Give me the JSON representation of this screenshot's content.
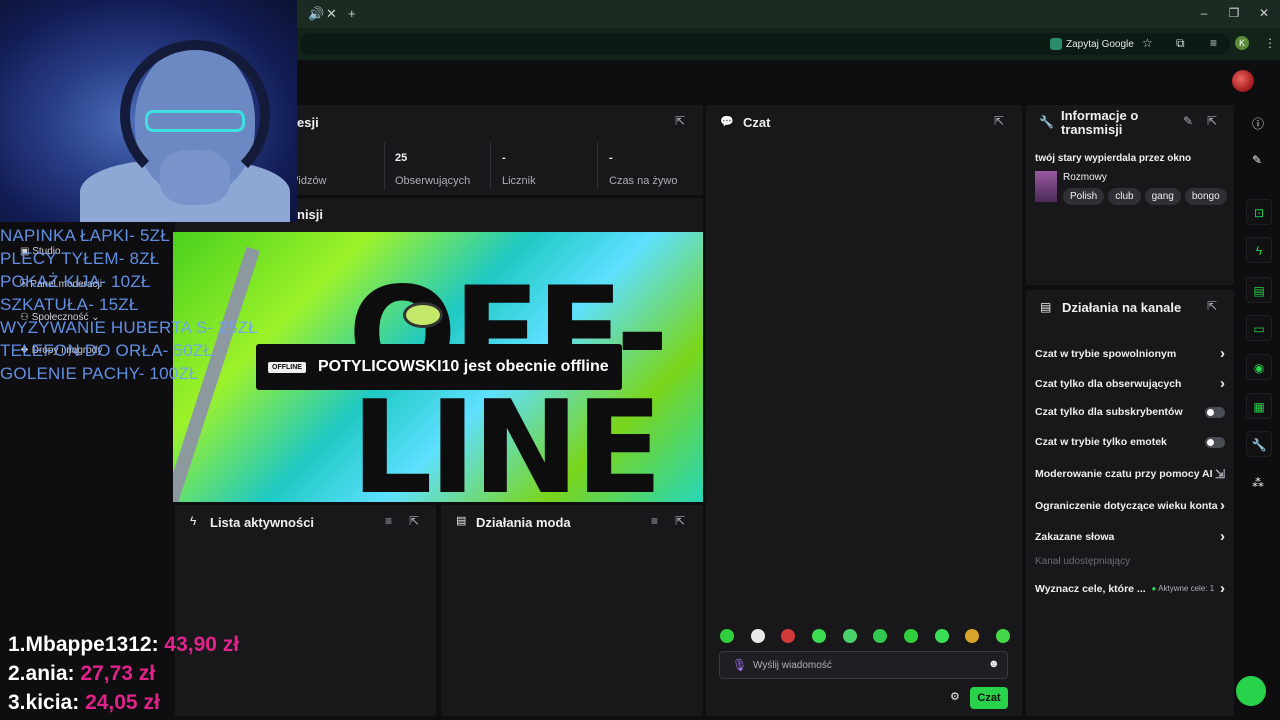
{
  "browser": {
    "tab_audio_icon": "speaker-icon",
    "tab_close": "✕",
    "new_tab": "+",
    "google_button": "Zapytaj Google",
    "profile_initial": "K",
    "window_controls": [
      "–",
      "❐",
      "✕"
    ]
  },
  "stats_panel": {
    "title_fragment": "esji",
    "stats": [
      {
        "value": "",
        "label": "Widzów"
      },
      {
        "value": "25",
        "label": "Obserwujących"
      },
      {
        "value": "-",
        "label": "Licznik subskrypcji"
      },
      {
        "value": "-",
        "label": "Czas na żywo"
      }
    ]
  },
  "preview_panel": {
    "title_fragment": "nisji"
  },
  "sidebar_menu": [
    "Studio",
    "Panel moderacji",
    "Społeczność",
    "Dropy i nagrody"
  ],
  "price_list": [
    "NAPINKA ŁAPKI- 5ZŁ",
    "PLECY TYŁEM- 8ZŁ",
    "POKAŻ KIJA- 10ZŁ",
    "SZKATUŁA- 15ZŁ",
    "WYZYWANIE HUBERTA S- 25ZŁ",
    "TELEFON DO ORŁA- 50ZŁ",
    "GOLENIE PACHY- 100ZŁ"
  ],
  "leaderboard": [
    {
      "rank": "1.",
      "name": "Mbappe1312:",
      "amount": "43,90 zł"
    },
    {
      "rank": "2.",
      "name": "ania:",
      "amount": "27,73 zł"
    },
    {
      "rank": "3.",
      "name": "kicia:",
      "amount": "24,05 zł"
    }
  ],
  "offline": {
    "big_word_1": "OFF-",
    "big_word_2": "LINE",
    "badge": "OFFLINE",
    "message": "POTYLICOWSKI10 jest obecnie offline"
  },
  "activity_panel": {
    "title": "Lista aktywności"
  },
  "mod_panel": {
    "title": "Działania moda"
  },
  "chat": {
    "title": "Czat",
    "input_placeholder": "Wyślij wiadomość",
    "send_label": "Czat",
    "emote_colors": [
      "#2fcf3f",
      "#e8e8e8",
      "#d43a3a",
      "#3ddc52",
      "#49d16a",
      "#30c84e",
      "#2fcf3f",
      "#3adf58",
      "#d9a52f",
      "#46d84a"
    ]
  },
  "info_panel": {
    "title": "Informacje o transmisji",
    "stream_title": "twój stary wypierdala przez okno",
    "category": "Rozmowy",
    "tags": [
      "Polish",
      "club",
      "gang",
      "bongo"
    ]
  },
  "channel_actions": {
    "title": "Działania na kanale",
    "items": [
      {
        "label": "Czat w trybie spowolnionym",
        "control": "chevron"
      },
      {
        "label": "Czat tylko dla obserwujących",
        "control": "chevron"
      },
      {
        "label": "Czat tylko dla subskrybentów",
        "control": "toggle"
      },
      {
        "label": "Czat w trybie tylko emotek",
        "control": "toggle"
      },
      {
        "label": "Moderowanie czatu przy pomocy AI",
        "control": "external"
      },
      {
        "label": "Ograniczenie dotyczące wieku konta",
        "control": "chevron"
      },
      {
        "label": "Zakazane słowa",
        "control": "chevron"
      }
    ],
    "shared_channel_label": "Kanał udostępniający",
    "goals_label": "Wyznacz cele, które ...",
    "goals_status": "Aktywne cele: 1"
  },
  "colors": {
    "accent": "#28d24a",
    "panel": "#18181b",
    "background": "#0e0e10"
  }
}
